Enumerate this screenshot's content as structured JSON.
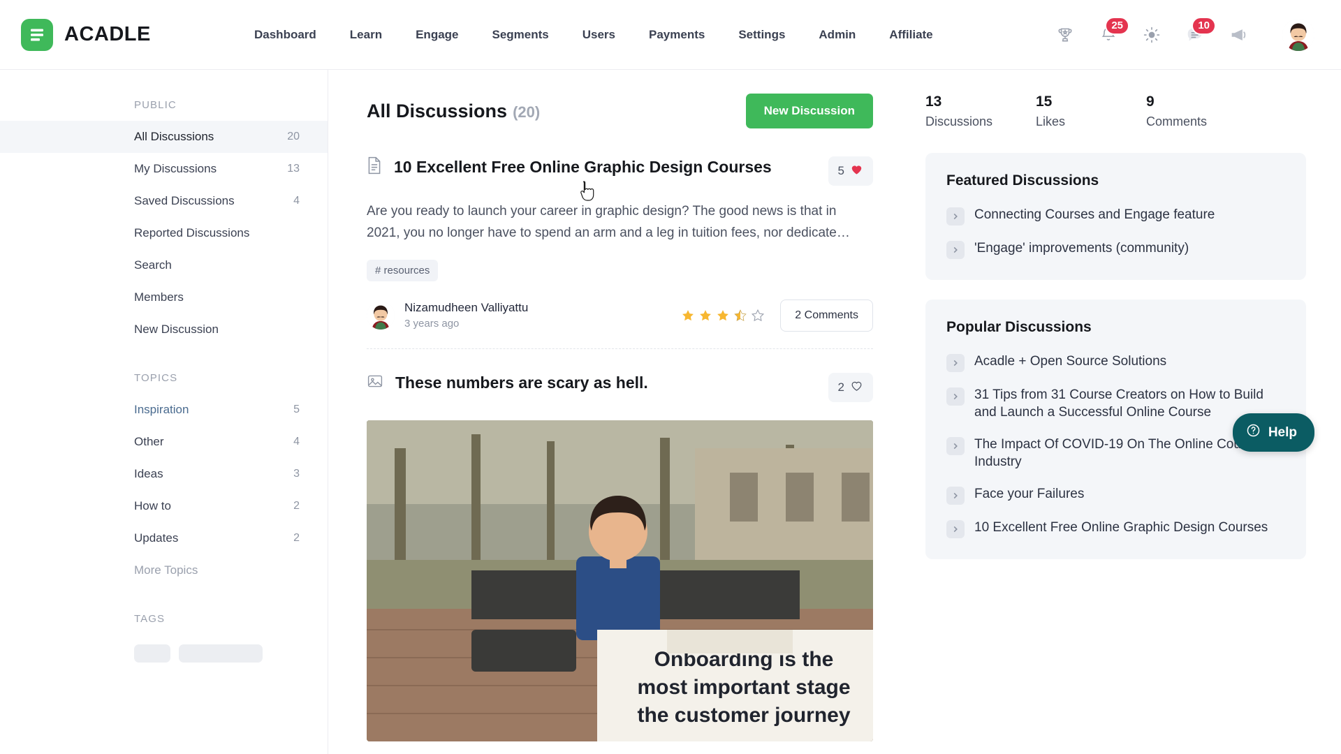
{
  "header": {
    "brand": "ACADLE",
    "brand_color": "#3fb95a",
    "nav": [
      {
        "label": "Dashboard"
      },
      {
        "label": "Learn"
      },
      {
        "label": "Engage"
      },
      {
        "label": "Segments"
      },
      {
        "label": "Users"
      },
      {
        "label": "Payments"
      },
      {
        "label": "Settings"
      },
      {
        "label": "Admin"
      },
      {
        "label": "Affiliate"
      }
    ],
    "icons": [
      {
        "name": "trophy-icon",
        "badge": null
      },
      {
        "name": "bell-icon",
        "badge": "25"
      },
      {
        "name": "brightness-icon",
        "badge": null
      },
      {
        "name": "chat-icon",
        "badge": "10"
      },
      {
        "name": "megaphone-icon",
        "badge": null
      }
    ],
    "badge_color": "#e4344f"
  },
  "sidebar": {
    "public_label": "PUBLIC",
    "public_items": [
      {
        "label": "All Discussions",
        "count": "20",
        "active": true
      },
      {
        "label": "My Discussions",
        "count": "13",
        "active": false
      },
      {
        "label": "Saved Discussions",
        "count": "4",
        "active": false
      },
      {
        "label": "Reported Discussions",
        "count": "",
        "active": false
      },
      {
        "label": "Search",
        "count": "",
        "active": false
      },
      {
        "label": "Members",
        "count": "",
        "active": false
      },
      {
        "label": "New Discussion",
        "count": "",
        "active": false
      }
    ],
    "topics_label": "TOPICS",
    "topics": [
      {
        "label": "Inspiration",
        "count": "5"
      },
      {
        "label": "Other",
        "count": "4"
      },
      {
        "label": "Ideas",
        "count": "3"
      },
      {
        "label": "How to",
        "count": "2"
      },
      {
        "label": "Updates",
        "count": "2"
      }
    ],
    "more_topics": "More Topics",
    "tags_label": "TAGS"
  },
  "main": {
    "title": "All Discussions",
    "title_count": "(20)",
    "new_discussion_button": "New Discussion",
    "posts": [
      {
        "type_icon": "document-icon",
        "title": "10 Excellent Free Online Graphic Design Courses",
        "like_count": "5",
        "liked": true,
        "excerpt": "Are you ready to launch your career in graphic design? The good news is that in 2021, you no longer have to spend an arm and a leg in tuition fees, nor dedicate…",
        "hashtag": "# resources",
        "author": "Nizamudheen Valliyattu",
        "time": "3 years ago",
        "rating": "3.5",
        "comments_button": "2 Comments"
      },
      {
        "type_icon": "image-icon",
        "title": "These numbers are scary as hell.",
        "like_count": "2",
        "liked": false,
        "media_caption_line1": "Onboarding is the",
        "media_caption_line2": "most important stage",
        "media_caption_line3": "the customer journey"
      }
    ]
  },
  "right": {
    "stats": [
      {
        "num": "13",
        "label": "Discussions"
      },
      {
        "num": "15",
        "label": "Likes"
      },
      {
        "num": "9",
        "label": "Comments"
      }
    ],
    "featured": {
      "title": "Featured Discussions",
      "items": [
        "Connecting Courses and Engage feature",
        "'Engage' improvements (community)"
      ]
    },
    "popular": {
      "title": "Popular Discussions",
      "items": [
        "Acadle + Open Source Solutions",
        "31 Tips from 31 Course Creators on How to Build and Launch a Successful Online Course",
        "The Impact Of COVID-19 On The Online Course Industry",
        "Face your Failures",
        "10 Excellent Free Online Graphic Design Courses"
      ]
    }
  },
  "help": {
    "label": "Help",
    "color": "#0b5c63"
  }
}
